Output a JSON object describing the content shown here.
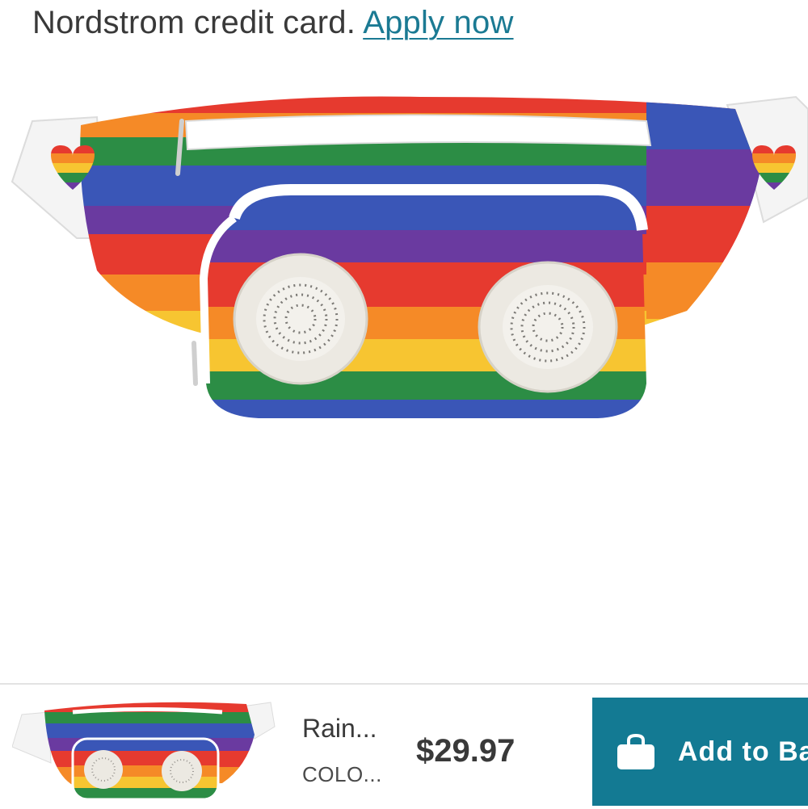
{
  "promo": {
    "text": "Nordstrom credit card.",
    "link": "Apply now"
  },
  "product": {
    "image_alt": "Rainbow fanny pack with speakers",
    "colors": {
      "red": "#e63a2f",
      "orange": "#f58a27",
      "yellow": "#f7c531",
      "green": "#2c8d45",
      "blue": "#3a56b7",
      "purple": "#6a3aa0",
      "speaker": "#ece9e2",
      "accent": "#137a93"
    }
  },
  "sticky_bar": {
    "name": "Rain...",
    "color": "COLO...",
    "price": "$29.97",
    "add_button": "Add to Ba",
    "bag_icon": "shopping-bag-icon"
  }
}
